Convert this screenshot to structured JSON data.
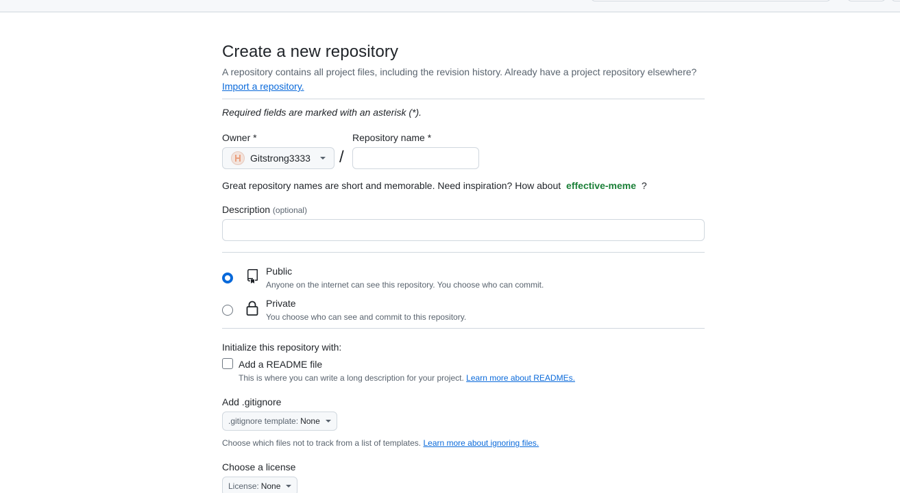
{
  "header": {
    "title": "Create a new repository",
    "subtitle": "A repository contains all project files, including the revision history. Already have a project repository elsewhere?",
    "import_link": "Import a repository."
  },
  "required_note": "Required fields are marked with an asterisk (*).",
  "owner": {
    "label": "Owner *",
    "value": "Gitstrong3333"
  },
  "slash": "/",
  "repo_name": {
    "label": "Repository name *",
    "value": "",
    "placeholder": ""
  },
  "name_hint": {
    "text": "Great repository names are short and memorable. Need inspiration? How about",
    "suggestion": "effective-meme",
    "suffix": "?"
  },
  "description": {
    "label": "Description",
    "optional": "(optional)",
    "value": "",
    "placeholder": ""
  },
  "visibility": {
    "options": [
      {
        "title": "Public",
        "desc": "Anyone on the internet can see this repository. You choose who can commit.",
        "icon": "repo-icon",
        "checked": true
      },
      {
        "title": "Private",
        "desc": "You choose who can see and commit to this repository.",
        "icon": "lock-icon",
        "checked": false
      }
    ]
  },
  "init": {
    "heading": "Initialize this repository with:",
    "readme_label": "Add a README file",
    "readme_desc": "This is where you can write a long description for your project.",
    "readme_link": "Learn more about READMEs."
  },
  "gitignore": {
    "heading": "Add .gitignore",
    "select_prefix": ".gitignore template:",
    "select_value": "None",
    "desc": "Choose which files not to track from a list of templates.",
    "link": "Learn more about ignoring files."
  },
  "license": {
    "heading": "Choose a license",
    "select_prefix": "License:",
    "select_value": "None"
  },
  "colors": {
    "accent": "#0969da",
    "success_text": "#1a7f37",
    "border": "#d0d7de",
    "muted": "#59636e"
  }
}
